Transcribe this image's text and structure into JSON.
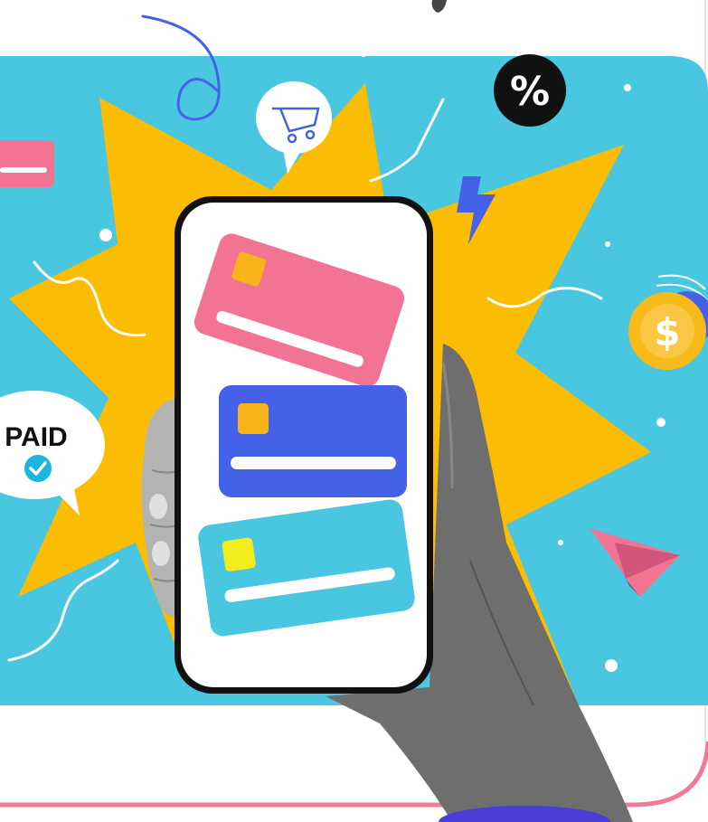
{
  "illustration": {
    "badge_text": "PAID",
    "percent_symbol": "%",
    "dollar_symbol": "$",
    "colors": {
      "background": "#ffffff",
      "panel": "#4ac7e0",
      "starburst": "#fbbc04",
      "frame_border": "#ee7a96",
      "card_pink": "#f27492",
      "card_blue": "#4561e8",
      "card_cyan": "#4ac7e0",
      "chip_orange": "#f7b318",
      "chip_yellow": "#f4ed1c",
      "check_badge": "#1db5de",
      "coin_gold": "#f7ba18",
      "lightning": "#4561e8",
      "paper_plane": "#f27492",
      "swirl_blue": "#4561e8"
    },
    "icons": [
      "shopping-cart-icon",
      "percent-icon",
      "lightning-icon",
      "dollar-coin-icon",
      "check-icon",
      "paper-plane-icon",
      "credit-card-icon"
    ]
  }
}
